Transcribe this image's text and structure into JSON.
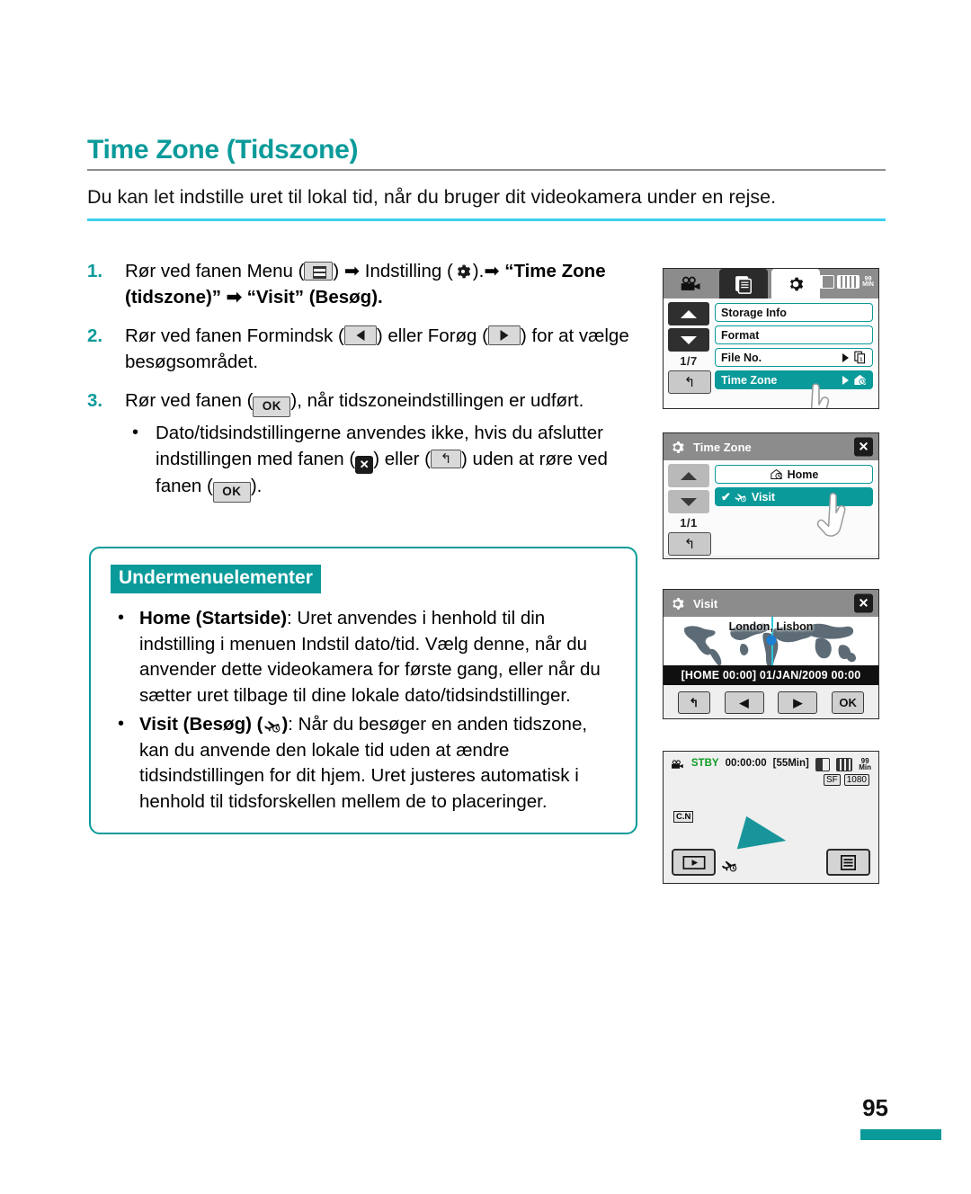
{
  "page": {
    "title": "Time Zone (Tidszone)",
    "intro": "Du kan let indstille uret til lokal tid, når du bruger dit videokamera under en rejse.",
    "page_number": "95",
    "accent_color": "#0a9a9a",
    "rule_color": "#3fd0ee"
  },
  "steps": [
    {
      "num": "1.",
      "part1": "Rør ved fanen Menu (",
      "icon1": "menu-icon",
      "part2": ") ➡ Indstilling (",
      "icon2": "gear-icon",
      "part3": ").➡ ",
      "bold1": "“Time Zone (tidszone)” ➡ “Visit” (Besøg)",
      "part4": "."
    },
    {
      "num": "2.",
      "part1": "Rør ved fanen Formindsk (",
      "icon1": "left-arrow-icon",
      "part2": ") eller Forøg (",
      "icon2": "right-arrow-icon",
      "part3": ") for at vælge besøgsområdet."
    },
    {
      "num": "3.",
      "part1": "Rør ved fanen (",
      "icon1": "ok-icon",
      "part2": "), når tidszoneindstillingen er udført."
    }
  ],
  "step3_bullet": {
    "dot": "•",
    "part1": "Dato/tidsindstillingerne anvendes ikke, hvis du afslutter indstillingen med fanen (",
    "icon1": "close-icon",
    "part2": ") eller (",
    "icon2": "back-icon",
    "part3": ") uden at røre ved fanen (",
    "icon3": "ok-icon",
    "part4": ")."
  },
  "submenu": {
    "badge": "Undermenuelementer",
    "items": [
      {
        "dot": "•",
        "bold": "Home (Startside)",
        "text": ": Uret anvendes i henhold til din indstilling i menuen Indstil dato/tid. Vælg denne, når du anvender dette videokamera for første gang, eller når du sætter uret tilbage til dine lokale dato/tidsindstillinger."
      },
      {
        "dot": "•",
        "bold_pre": "Visit (Besøg) (",
        "icon": "airplane-clock-icon",
        "bold_post": ")",
        "text": ": Når du besøger en anden tidszone, kan du anvende den lokale tid uden at ændre tidsindstillingen for dit hjem. Uret justeres automatisk i henhold til tidsforskellen mellem de to placeringer."
      }
    ]
  },
  "screens": {
    "menu": {
      "name": "settings-menu-screen",
      "tabs": [
        {
          "name": "tab-camcorder",
          "icon": "camcorder-icon",
          "state": "inactive"
        },
        {
          "name": "tab-playback",
          "icon": "file-pages-icon",
          "state": "dark"
        },
        {
          "name": "tab-settings",
          "icon": "gear-icon",
          "state": "active"
        }
      ],
      "status_icons": [
        "sd-card-icon",
        "battery-icon",
        "min-icon"
      ],
      "page_indicator": "1/7",
      "up_label": "▲",
      "down_label": "▼",
      "back_label": "↰",
      "rows": [
        {
          "label": "Storage Info",
          "selected": false,
          "arrow": false,
          "icon": ""
        },
        {
          "label": "Format",
          "selected": false,
          "arrow": false,
          "icon": ""
        },
        {
          "label": "File No.",
          "selected": false,
          "arrow": true,
          "icon": "file-copy-icon"
        },
        {
          "label": "Time Zone",
          "selected": true,
          "arrow": true,
          "icon": "home-clock-icon"
        }
      ]
    },
    "timezone": {
      "name": "time-zone-screen",
      "title": "Time Zone",
      "title_icon": "gear-icon",
      "close_label": "✕",
      "page_indicator": "1/1",
      "back_label": "↰",
      "rows": [
        {
          "label": "Home",
          "icon": "home-clock-icon",
          "selected": false,
          "check": false
        },
        {
          "label": "Visit",
          "icon": "airplane-clock-icon",
          "selected": true,
          "check": true
        }
      ]
    },
    "visit": {
      "name": "visit-map-screen",
      "title": "Visit",
      "title_icon": "gear-icon",
      "close_label": "✕",
      "map_label": "London, Lisbon",
      "time_text": "[HOME 00:00] 01/JAN/2009 00:00",
      "buttons": [
        {
          "name": "back-button",
          "label": "↰"
        },
        {
          "name": "prev-button",
          "label": "◀"
        },
        {
          "name": "next-button",
          "label": "▶"
        },
        {
          "name": "ok-button",
          "label": "OK"
        }
      ]
    },
    "standby": {
      "name": "record-standby-screen",
      "camera_icon": "camcorder-icon",
      "status": "STBY",
      "timecode": "00:00:00",
      "remaining": "[55Min]",
      "storage_icon": "sd-card-icon",
      "battery_icon": "battery-icon",
      "min_badge": "Min",
      "quality_badge": "1080",
      "sf_badge": "SF",
      "cn_badge": "C.N",
      "play_icon": "play-icon",
      "menu_icon": "menu-list-icon",
      "plane_icon": "airplane-clock-icon"
    }
  }
}
